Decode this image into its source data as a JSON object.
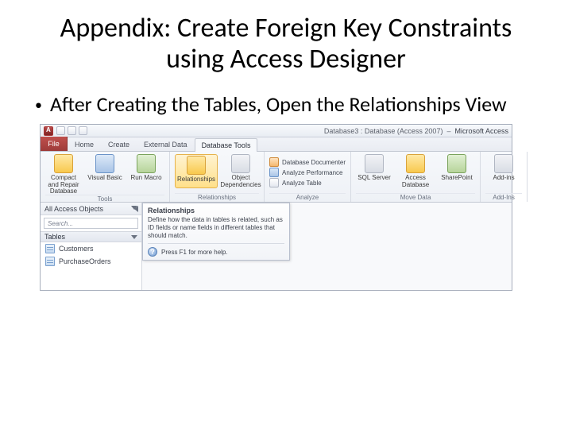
{
  "slide": {
    "title": "Appendix: Create Foreign Key Constraints using Access Designer",
    "bullet": "After Creating the Tables, Open the Relationships View"
  },
  "titlebar": {
    "doc": "Database3 : Database (Access 2007)",
    "product": "Microsoft Access"
  },
  "tabs": {
    "file": "File",
    "items": [
      "Home",
      "Create",
      "External Data",
      "Database Tools"
    ],
    "active_index": 3
  },
  "ribbon": {
    "groups": [
      {
        "label": "Tools",
        "big": [
          {
            "name": "compact-repair",
            "text": "Compact and Repair Database",
            "cls": "yel"
          },
          {
            "name": "visual-basic",
            "text": "Visual Basic",
            "cls": "bl"
          },
          {
            "name": "run-macro",
            "text": "Run Macro",
            "cls": "gn"
          }
        ]
      },
      {
        "label": "Relationships",
        "big": [
          {
            "name": "relationships",
            "text": "Relationships",
            "cls": "yel",
            "selected": true
          },
          {
            "name": "object-dependencies",
            "text": "Object Dependencies",
            "cls": "gr"
          }
        ]
      },
      {
        "label": "Analyze",
        "small": [
          {
            "name": "db-documenter",
            "text": "Database Documenter",
            "cls": "o"
          },
          {
            "name": "analyze-perf",
            "text": "Analyze Performance",
            "cls": "b"
          },
          {
            "name": "analyze-table",
            "text": "Analyze Table",
            "cls": ""
          }
        ]
      },
      {
        "label": "Move Data",
        "big": [
          {
            "name": "sql-server",
            "text": "SQL Server",
            "cls": "gr"
          },
          {
            "name": "access-db",
            "text": "Access Database",
            "cls": "yel"
          },
          {
            "name": "sharepoint",
            "text": "SharePoint",
            "cls": "gn"
          }
        ]
      },
      {
        "label": "Add-Ins",
        "big": [
          {
            "name": "addins",
            "text": "Add-ins",
            "cls": "gr"
          }
        ]
      }
    ]
  },
  "nav": {
    "header": "All Access Objects",
    "search_placeholder": "Search...",
    "category": "Tables",
    "items": [
      "Customers",
      "PurchaseOrders"
    ]
  },
  "tooltip": {
    "title": "Relationships",
    "body": "Define how the data in tables is related, such as ID fields or name fields in different tables that should match.",
    "help": "Press F1 for more help."
  }
}
